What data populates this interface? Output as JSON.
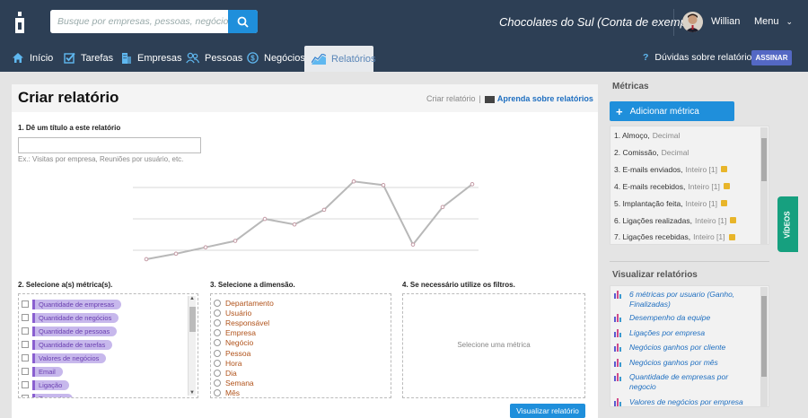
{
  "header": {
    "search_placeholder": "Busque por empresas, pessoas, negócios, etc...",
    "account": "Chocolates do Sul (Conta de exemplo)",
    "user": "Willian",
    "menu": "Menu"
  },
  "nav": {
    "items": [
      {
        "label": "Início",
        "icon": "home-icon"
      },
      {
        "label": "Tarefas",
        "icon": "check-icon"
      },
      {
        "label": "Empresas",
        "icon": "building-icon"
      },
      {
        "label": "Pessoas",
        "icon": "people-icon"
      },
      {
        "label": "Negócios",
        "icon": "dollar-icon"
      },
      {
        "label": "Relatórios",
        "icon": "chart-icon"
      }
    ],
    "help": "Dúvidas sobre relatórios",
    "subscribe": "ASSINAR"
  },
  "main": {
    "title": "Criar relatório",
    "crumb_current": "Criar relatório",
    "crumb_sep": "|",
    "learn": "Aprenda sobre relatórios",
    "step1": "1. Dê um título a este relatório",
    "step1_hint": "Ex.: Visitas por empresa, Reuniões por usuário, etc.",
    "step2": "2. Selecione a(s) métrica(s).",
    "step3": "3. Selecione a dimensão.",
    "step4": "4. Se necessário utilize os filtros.",
    "filter_hint": "Selecione uma métrica",
    "submit": "Visualizar relatório",
    "metrics": [
      "Quantidade de empresas",
      "Quantidade de negócios",
      "Quantidade de pessoas",
      "Quantidade de tarefas",
      "Valores de negócios",
      "Email",
      "Ligação",
      "Proposta"
    ],
    "dimensions": [
      "Departamento",
      "Usuário",
      "Responsável",
      "Empresa",
      "Negócio",
      "Pessoa",
      "Hora",
      "Dia",
      "Semana",
      "Mês"
    ]
  },
  "chart_data": {
    "type": "line",
    "x": [
      1,
      2,
      3,
      4,
      5,
      6,
      7,
      8,
      9,
      10,
      11,
      12
    ],
    "values": [
      2,
      8,
      15,
      22,
      46,
      40,
      56,
      87,
      83,
      18,
      59,
      84
    ],
    "ylim": [
      0,
      100
    ],
    "grid": true,
    "decorative": true
  },
  "sidebar": {
    "metrics_title": "Métricas",
    "add_metric": "Adicionar métrica",
    "metrics": [
      {
        "label": "1. Almoço,",
        "type": "Decimal",
        "locked": false
      },
      {
        "label": "2. Comissão,",
        "type": "Decimal",
        "locked": false
      },
      {
        "label": "3. E-mails enviados,",
        "type": "Inteiro [1]",
        "locked": true
      },
      {
        "label": "4. E-mails recebidos,",
        "type": "Inteiro [1]",
        "locked": true
      },
      {
        "label": "5. Implantação feita,",
        "type": "Inteiro [1]",
        "locked": true
      },
      {
        "label": "6. Ligações realizadas,",
        "type": "Inteiro [1]",
        "locked": true
      },
      {
        "label": "7. Ligações recebidas,",
        "type": "Inteiro [1]",
        "locked": true
      }
    ],
    "reports_title": "Visualizar relatórios",
    "reports": [
      "6 métricas por usuario (Ganho, Finalizadas)",
      "Desempenho da equipe",
      "Ligações por empresa",
      "Negócios ganhos por cliente",
      "Negócios ganhos por mês",
      "Quantidade de empresas por negocio",
      "Valores de negócios por empresa"
    ],
    "videos": "VÍDEOS"
  },
  "colors": {
    "topbar": "#2d3f55",
    "accent": "#1f8fdb",
    "tag": "#c7b8ec",
    "videos": "#16a07f"
  }
}
